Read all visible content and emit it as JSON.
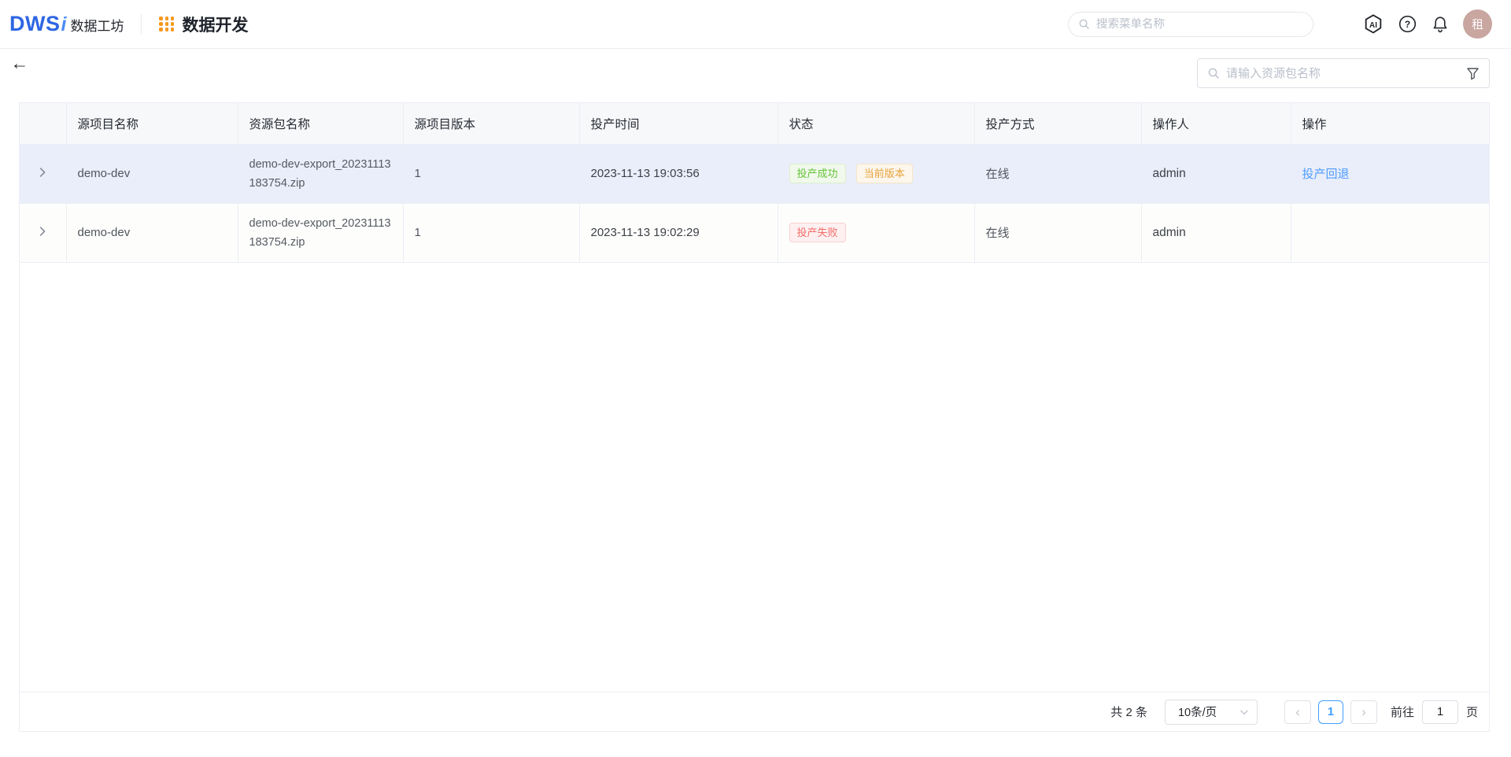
{
  "navbar": {
    "logo_dws": "DWS",
    "logo_i": "i",
    "logo_brand": "数据工坊",
    "app_title": "数据开发",
    "search_placeholder": "搜索菜单名称",
    "ai_badge": "AI",
    "help_glyph": "?",
    "avatar_text": "租"
  },
  "toolbar": {
    "filter_placeholder": "请输入资源包名称"
  },
  "table": {
    "columns": [
      "源项目名称",
      "资源包名称",
      "源项目版本",
      "投产时间",
      "状态",
      "投产方式",
      "操作人",
      "操作"
    ],
    "rows": [
      {
        "source_project": "demo-dev",
        "package_name": "demo-dev-export_20231113183754.zip",
        "version": "1",
        "time": "2023-11-13 19:03:56",
        "status_tag": "投产成功",
        "status_type": "success",
        "version_tag": "当前版本",
        "method": "在线",
        "operator": "admin",
        "action_label": "投产回退"
      },
      {
        "source_project": "demo-dev",
        "package_name": "demo-dev-export_20231113183754.zip",
        "version": "1",
        "time": "2023-11-13 19:02:29",
        "status_tag": "投产失败",
        "status_type": "danger",
        "version_tag": "",
        "method": "在线",
        "operator": "admin",
        "action_label": ""
      }
    ]
  },
  "pagination": {
    "total_text": "共 2 条",
    "page_size": "10条/页",
    "current_page": "1",
    "goto_label": "前往",
    "goto_value": "1",
    "unit_label": "页"
  },
  "icons": {
    "back_arrow": "←",
    "chevron_left": "‹",
    "chevron_right": "›"
  },
  "colors": {
    "accent_blue": "#409eff",
    "link_blue": "#4f9bff",
    "success_green": "#67c23a",
    "warning_orange": "#e6a23c",
    "danger_red": "#f56c6c",
    "brand_blue": "#2e66e3",
    "brand_orange": "#f59a23",
    "avatar_bg": "#c9a6a0",
    "row_highlight": "#e9eefa",
    "header_bg": "#f7f8fa",
    "border": "#ebeef5"
  }
}
